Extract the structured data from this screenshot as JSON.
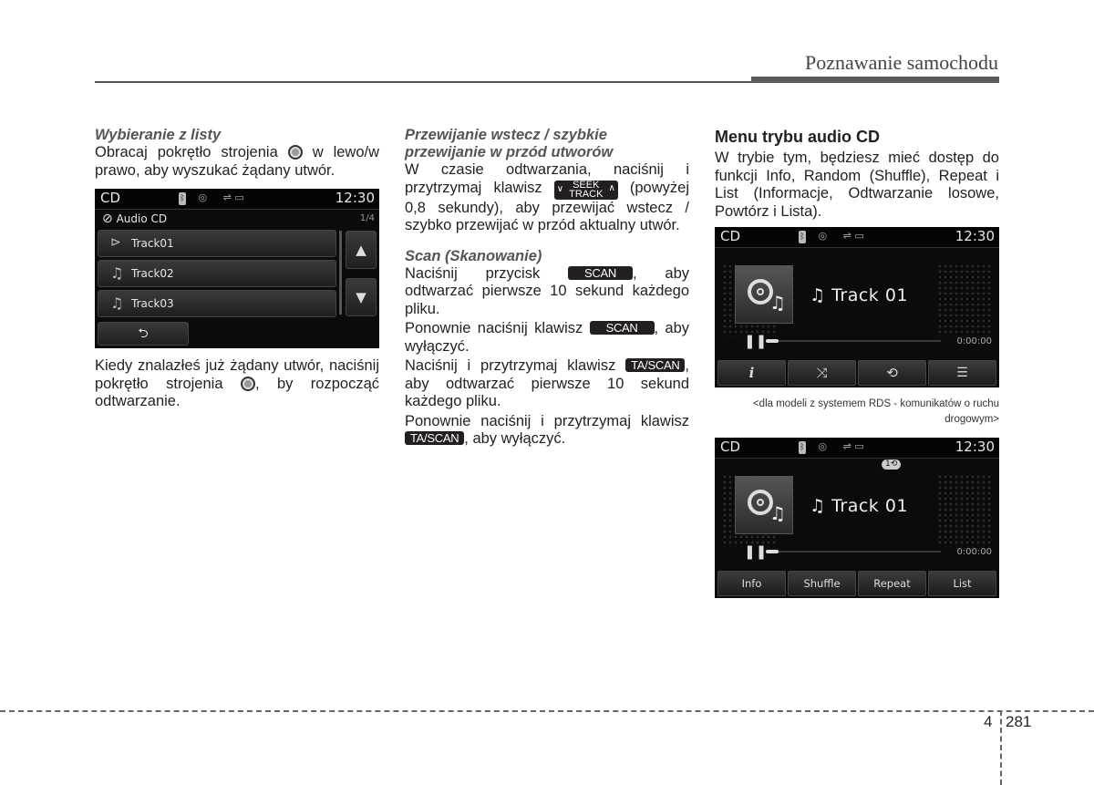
{
  "header": {
    "title": "Poznawanie samochodu"
  },
  "col1": {
    "subtitle": "Wybieranie z listy",
    "p1_a": "Obracaj pokrętło strojenia",
    "p1_b": "w lewo/w prawo, aby wyszukać żądany utwór.",
    "screen": {
      "mode": "CD",
      "clock": "12:30",
      "source_label": "Audio CD",
      "page_indicator": "1/4",
      "tracks": [
        "Track01",
        "Track02",
        "Track03"
      ],
      "up_icon": "▲",
      "down_icon": "▼",
      "back_icon": "⮌"
    },
    "p2_a": "Kiedy znalazłeś już żądany utwór, naciśnij pokrętło strojenia",
    "p2_b": ", by rozpocząć odtwarzanie."
  },
  "col2": {
    "subtitle": "Przewijanie wstecz / szybkie przewijanie w przód utworów",
    "p1_a": "W czasie odtwarzania, naciśnij i przytrzymaj klawisz",
    "seek_top": "SEEK",
    "seek_bottom": "TRACK",
    "p1_b": "(powyżej 0,8 sekundy), aby przewijać wstecz / szybko przewijać w przód aktualny utwór.",
    "scan_subtitle": "Scan (Skanowanie)",
    "p2_a": "Naciśnij przycisk",
    "scan_key": "SCAN",
    "p2_b": ", aby odtwarzać pierwsze 10 sekund każdego pliku.",
    "p3_a": "Ponownie naciśnij klawisz",
    "p3_b": ", aby wyłączyć.",
    "p4_a": "Naciśnij i przytrzymaj klawisz",
    "tascan_key": "TA/SCAN",
    "p4_b": ", aby odtwarzać pierwsze 10 sekund każdego pliku.",
    "p5_a": "Ponownie naciśnij i przytrzymaj klawisz",
    "p5_b": ", aby wyłączyć."
  },
  "col3": {
    "heading": "Menu trybu audio CD",
    "p1": "W trybie tym, będziesz mieć dostęp do funkcji Info, Random (Shuffle), Repeat i List (Informacje, Odtwarzanie losowe, Powtórz i Lista).",
    "screen1": {
      "mode": "CD",
      "clock": "12:30",
      "track": "Track 01",
      "time": "0:00:00",
      "buttons": [
        "i",
        "⤨",
        "⟲",
        "☰"
      ]
    },
    "caption": "<dla modeli z systemem RDS - komunikatów o ruchu drogowym>",
    "screen2": {
      "mode": "CD",
      "clock": "12:30",
      "track": "Track 01",
      "time": "0:00:00",
      "repeat_badge": "1⟲",
      "buttons": [
        "Info",
        "Shuffle",
        "Repeat",
        "List"
      ]
    }
  },
  "footer": {
    "chapter": "4",
    "page": "281"
  }
}
